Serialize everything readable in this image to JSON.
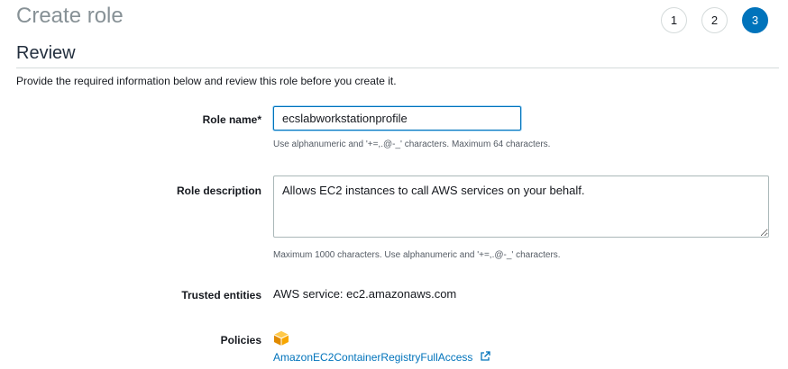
{
  "page": {
    "title": "Create role",
    "steps": [
      "1",
      "2",
      "3"
    ],
    "active_step": 3
  },
  "review": {
    "heading": "Review",
    "intro": "Provide the required information below and review this role before you create it."
  },
  "form": {
    "role_name": {
      "label": "Role name*",
      "value": "ecslabworkstationprofile",
      "hint": "Use alphanumeric and '+=,.@-_' characters. Maximum 64 characters."
    },
    "role_description": {
      "label": "Role description",
      "value": "Allows EC2 instances to call AWS services on your behalf.",
      "hint": "Maximum 1000 characters. Use alphanumeric and '+=,.@-_' characters."
    },
    "trusted_entities": {
      "label": "Trusted entities",
      "value": "AWS service: ec2.amazonaws.com"
    },
    "policies": {
      "label": "Policies",
      "icon": "aws-policy-icon",
      "items": [
        "AmazonEC2ContainerRegistryFullAccess"
      ]
    }
  },
  "colors": {
    "accent": "#0073bb",
    "policy_icon": "#f7a600"
  }
}
